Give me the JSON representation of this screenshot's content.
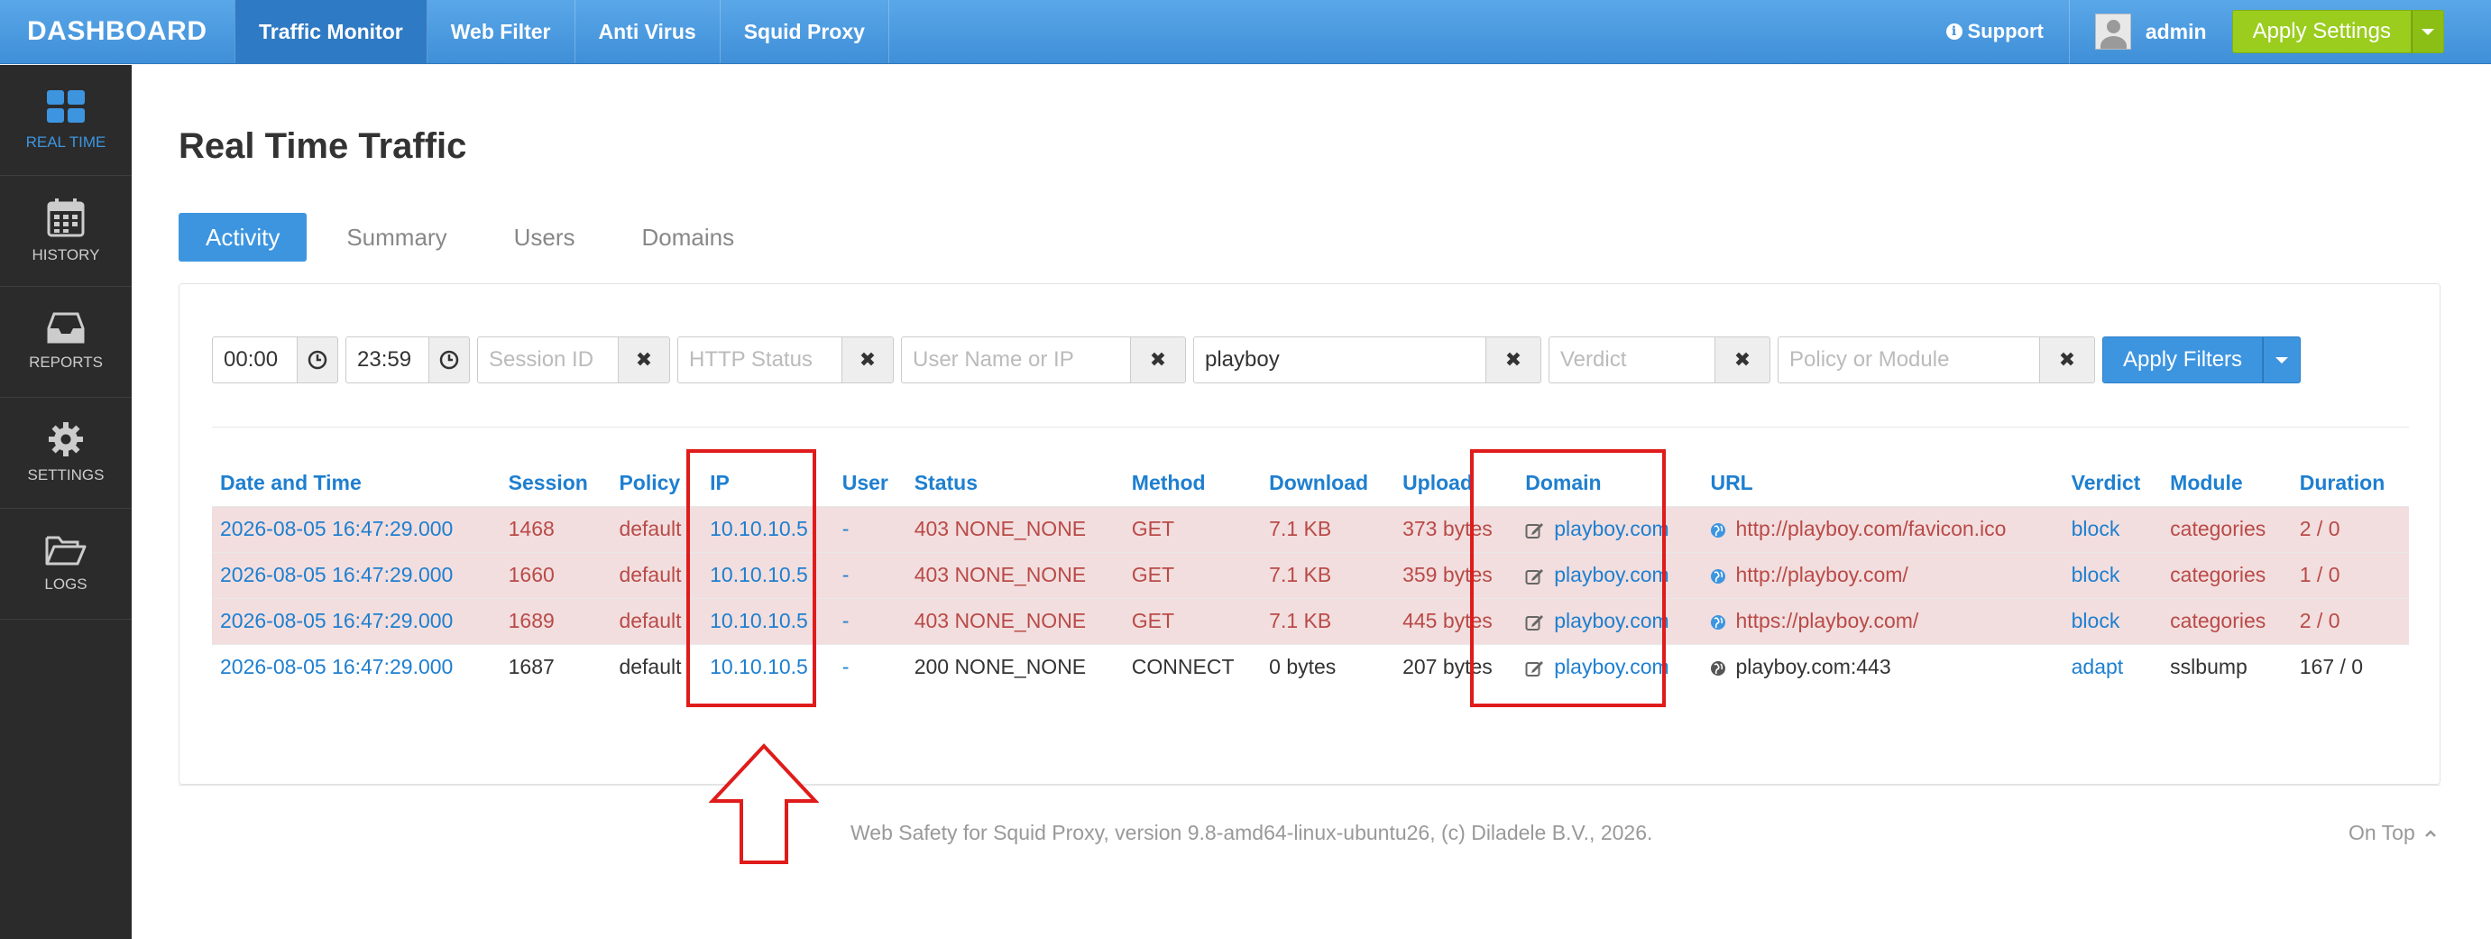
{
  "header": {
    "brand": "DASHBOARD",
    "nav": [
      "Traffic Monitor",
      "Web Filter",
      "Anti Virus",
      "Squid Proxy"
    ],
    "support": "Support",
    "user": "admin",
    "apply_settings": "Apply Settings"
  },
  "sidebar": {
    "items": [
      "REAL TIME",
      "HISTORY",
      "REPORTS",
      "SETTINGS",
      "LOGS"
    ]
  },
  "main": {
    "title": "Real Time Traffic",
    "tabs": [
      "Activity",
      "Summary",
      "Users",
      "Domains"
    ],
    "filters": {
      "time_from": "00:00",
      "time_to": "23:59",
      "session_placeholder": "Session ID",
      "http_status_placeholder": "HTTP Status",
      "user_placeholder": "User Name or IP",
      "domain_value": "playboy",
      "verdict_placeholder": "Verdict",
      "policy_placeholder": "Policy or Module",
      "apply": "Apply Filters"
    },
    "table": {
      "columns": [
        "Date and Time",
        "Session",
        "Policy",
        "IP",
        "User",
        "Status",
        "Method",
        "Download",
        "Upload",
        "Domain",
        "URL",
        "Verdict",
        "Module",
        "Duration"
      ],
      "rows": [
        {
          "datetime": "2026-08-05 16:47:29.000",
          "session": "1468",
          "policy": "default",
          "ip": "10.10.10.5",
          "user": "-",
          "status": "403 NONE_NONE",
          "method": "GET",
          "download": "7.1 KB",
          "upload": "373 bytes",
          "domain": "playboy.com",
          "url": "http://playboy.com/favicon.ico",
          "verdict": "block",
          "module": "categories",
          "duration": "2 / 0"
        },
        {
          "datetime": "2026-08-05 16:47:29.000",
          "session": "1660",
          "policy": "default",
          "ip": "10.10.10.5",
          "user": "-",
          "status": "403 NONE_NONE",
          "method": "GET",
          "download": "7.1 KB",
          "upload": "359 bytes",
          "domain": "playboy.com",
          "url": "http://playboy.com/",
          "verdict": "block",
          "module": "categories",
          "duration": "1 / 0"
        },
        {
          "datetime": "2026-08-05 16:47:29.000",
          "session": "1689",
          "policy": "default",
          "ip": "10.10.10.5",
          "user": "-",
          "status": "403 NONE_NONE",
          "method": "GET",
          "download": "7.1 KB",
          "upload": "445 bytes",
          "domain": "playboy.com",
          "url": "https://playboy.com/",
          "verdict": "block",
          "module": "categories",
          "duration": "2 / 0"
        },
        {
          "datetime": "2026-08-05 16:47:29.000",
          "session": "1687",
          "policy": "default",
          "ip": "10.10.10.5",
          "user": "-",
          "status": "200 NONE_NONE",
          "method": "CONNECT",
          "download": "0 bytes",
          "upload": "207 bytes",
          "domain": "playboy.com",
          "url": "playboy.com:443",
          "verdict": "adapt",
          "module": "sslbump",
          "duration": "167 / 0"
        }
      ]
    }
  },
  "footer": {
    "text": "Web Safety for Squid Proxy, version 9.8-amd64-linux-ubuntu26, (c) Diladele B.V., 2026.",
    "on_top": "On Top"
  },
  "colors": {
    "accent": "#3d95e0",
    "apply_green": "#9acd1e",
    "blocked_row": "#f2dede",
    "annotation": "#e01b1b"
  }
}
